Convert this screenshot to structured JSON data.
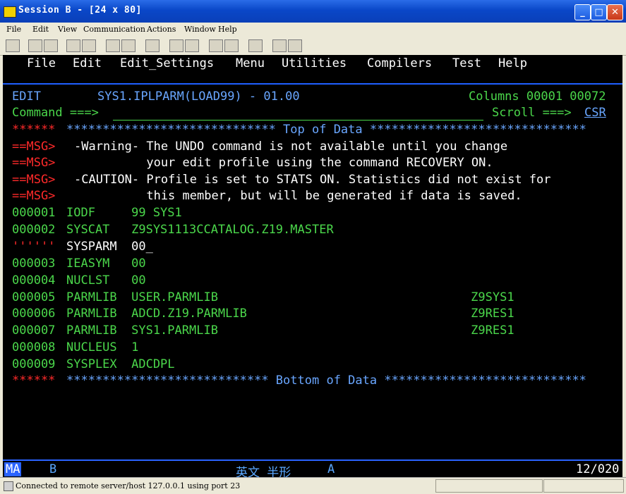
{
  "window": {
    "title": "Session B - [24 x 80]",
    "controls": [
      "minimize",
      "maximize",
      "close"
    ]
  },
  "menubar": [
    "File",
    "Edit",
    "View",
    "Communication",
    "Actions",
    "Window",
    "Help"
  ],
  "toolbar_icons": [
    "print-screen-icon",
    "copy-icon",
    "paste-icon",
    "send-icon",
    "receive-icon",
    "display-icon",
    "color-icon",
    "map-icon",
    "record-icon",
    "play-icon",
    "macro-icon",
    "run-icon",
    "clipboard-icon",
    "globe-icon",
    "edit-icon"
  ],
  "ispf_menu": [
    "File",
    "Edit",
    "Edit_Settings",
    "Menu",
    "Utilities",
    "Compilers",
    "Test",
    "Help"
  ],
  "header": {
    "mode": "EDIT",
    "dataset": "SYS1.IPLPARM(LOAD99) - 01.00",
    "columns": "Columns 00001 00072",
    "command_label": "Command ===>",
    "command_value": "",
    "scroll_label": "Scroll ===>",
    "scroll_value": "CSR"
  },
  "top_line": {
    "prefix": "******",
    "text": "***************************** Top of Data ******************************"
  },
  "messages": [
    {
      "prefix": "==MSG>",
      "text": "-Warning- The UNDO command is not available until you change"
    },
    {
      "prefix": "==MSG>",
      "text": "          your edit profile using the command RECOVERY ON."
    },
    {
      "prefix": "==MSG>",
      "text": "-CAUTION- Profile is set to STATS ON. Statistics did not exist for"
    },
    {
      "prefix": "==MSG>",
      "text": "          this member, but will be generated if data is saved."
    }
  ],
  "data_lines": [
    {
      "num": "000001",
      "text": "IODF     99 SYS1"
    },
    {
      "num": "000002",
      "text": "SYSCAT   Z9SYS1113CCATALOG.Z19.MASTER"
    },
    {
      "num": "''''''",
      "text": "SYSPARM  00_"
    },
    {
      "num": "000003",
      "text": "IEASYM   00"
    },
    {
      "num": "000004",
      "text": "NUCLST   00"
    },
    {
      "num": "000005",
      "text": "PARMLIB  USER.PARMLIB                                   Z9SYS1"
    },
    {
      "num": "000006",
      "text": "PARMLIB  ADCD.Z19.PARMLIB                               Z9RES1"
    },
    {
      "num": "000007",
      "text": "PARMLIB  SYS1.PARMLIB                                   Z9RES1"
    },
    {
      "num": "000008",
      "text": "NUCLEUS  1"
    },
    {
      "num": "000009",
      "text": "SYSPLEX  ADCDPL"
    }
  ],
  "bottom_line": {
    "prefix": "******",
    "text": "**************************** Bottom of Data ****************************"
  },
  "oia": {
    "ma": "MA",
    "session": "B",
    "ime": "英文 半形",
    "ime_mode": "A",
    "cursor": "12/020"
  },
  "statusbar": {
    "message": "Connected to remote server/host 127.0.0.1 using port 23"
  },
  "colors": {
    "green": "#4bd74b",
    "blue": "#69a6ff",
    "red": "#ff2a2a",
    "white": "#ffffff",
    "background": "#000000"
  }
}
